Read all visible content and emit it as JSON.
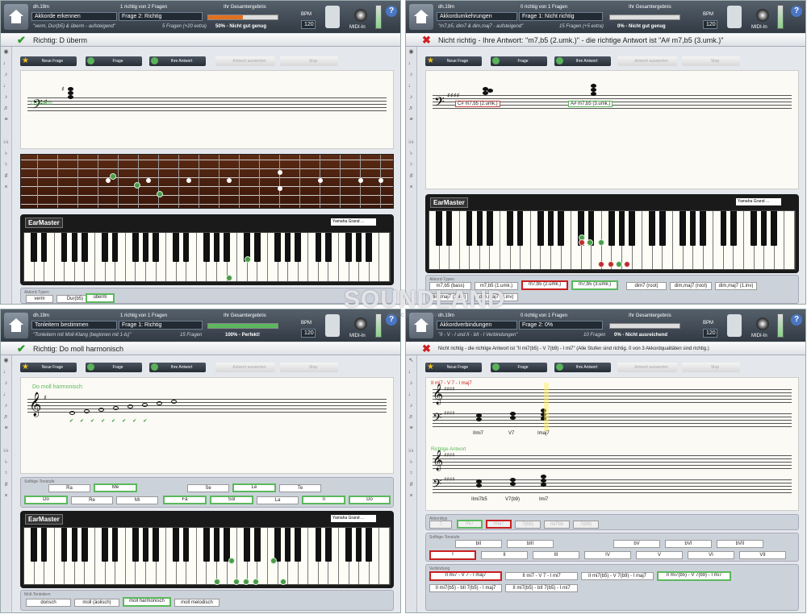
{
  "panels": [
    {
      "user": "dh.19m",
      "progress": "1 richtig von 2 Fragen",
      "result_title": "Ihr Gesamtergebnis",
      "exercise": "Akkorde erkennen",
      "question": "Frage 2: Richtig",
      "subtitle": "\"verm, Dur(b5) & überm - aufsteigend\"",
      "questions_count": "5 Fragen (+20 extra)",
      "score_text": "50% - Nicht gut genug",
      "score_fraction": 0.5,
      "score_color": "#e07020",
      "bpm_label": "BPM",
      "bpm": "120",
      "midi_label": "MIDI-In",
      "result": "Richtig: D überm",
      "result_ok": true,
      "staff_label": "D überm"
    },
    {
      "user": "dh.19m",
      "progress": "0 richtig von 1 Fragen",
      "result_title": "Ihr Gesamtergebnis",
      "exercise": "Akkordumkehrungen",
      "question": "Frage 1: Nicht richtig",
      "subtitle": "\"m7,b5, dim7 & dim,maj7 - aufsteigend\"",
      "questions_count": "15 Fragen (+5 extra)",
      "score_text": "0% - Nicht gut genug",
      "score_fraction": 0,
      "score_color": "#e07020",
      "bpm_label": "BPM",
      "bpm": "120",
      "midi_label": "MIDI-In",
      "result": "Nicht richtig - Ihre Antwort: \"m7,b5 (2.umk.)\" - die richtige Antwort ist \"A# m7,b5 (3.umk.)\"",
      "result_ok": false,
      "staff_label_1": "C# m7,b5 (2.umk.)",
      "staff_label_2": "A# m7,b5 (3.umk.)"
    },
    {
      "user": "dh.19m",
      "progress": "1 richtig von 1 Fragen",
      "result_title": "Ihr Gesamtergebnis",
      "exercise": "Tonleitern bestimmen",
      "question": "Frage 1: Richtig",
      "subtitle": "\"Tonleitern mit Moll-Klang (beginnen mit 1-ls)\"",
      "questions_count": "15 Fragen",
      "score_text": "100% - Perfekt!",
      "score_fraction": 1,
      "score_color": "#5cb85c",
      "bpm_label": "BPM",
      "bpm": "120",
      "midi_label": "MIDI-In",
      "result": "Richtig: Do moll harmonisch",
      "result_ok": true,
      "staff_label": "Do moll harmonisch"
    },
    {
      "user": "dh.19m",
      "progress": "0 richtig von 1 Fragen",
      "result_title": "Ihr Gesamtergebnis",
      "exercise": "Akkordverbindungen",
      "question": "Frage 2: 0%",
      "subtitle": "\"II - V - I und II - bII - I Verbindungen\"",
      "questions_count": "10 Fragen",
      "score_text": "0% - Nicht ausreichend",
      "score_fraction": 0,
      "score_color": "#e07020",
      "bpm_label": "BPM",
      "bpm": "120",
      "midi_label": "MIDI-In",
      "result": "Nicht richtig - die richtige Antwort ist \"II mi7(b5) - V 7(b9) - I mi7\" (Alle Stufen sind richtig. 0 von 3 Akkordqualitäten sind richtig.)",
      "result_ok": false,
      "staff_label_top": "II mi7 - V 7 - I maj7",
      "staff_label_bottom": "Richtige Antwort",
      "chord_labels_top": [
        "IImi7",
        "V7",
        "Imaj7"
      ],
      "chord_labels_bottom": [
        "IImi7b5",
        "V7(b9)",
        "Imi7"
      ]
    }
  ],
  "toolbar": {
    "new": "Neue Frage",
    "question": "Frage",
    "your_answer": "Ihre Antwort",
    "check": "Antwort auswerten",
    "stop": "Stop"
  },
  "piano": {
    "logo": "EarMaster",
    "instrument": "Yamaha Grand ..."
  },
  "q1_answers": {
    "header": "Akkord-Typen",
    "items": [
      "verm",
      "Dur(b5)",
      "überm"
    ],
    "correct": 2
  },
  "q2_answers": {
    "header": "Akkord-Typen",
    "items": [
      "m7,b5 (bass)",
      "m7,b5 (1.umk.)",
      "m7,b5 (2.umk.)",
      "m7,b5 (3.umk.)",
      "dim7 (root)",
      "dim,maj7 (root)",
      "dim,maj7 (1.inv)",
      "dim,maj7 (2.inv)",
      "dim,maj7 (3.inv)"
    ]
  },
  "q3_solfege": {
    "header": "Solfège-Tonstufe",
    "row1": [
      "Ra",
      "Me",
      "Se",
      "Le",
      "Te"
    ],
    "row2": [
      "Do",
      "Re",
      "Mi",
      "Fa",
      "Sol",
      "La",
      "Ti",
      "Do"
    ],
    "scale_header": "Moll-Tonleitern",
    "scales": [
      "dorisch",
      "moll (äolisch)",
      "moll harmonisch",
      "moll melodisch"
    ]
  },
  "q4_answers": {
    "quality_header": "Akkordtyp",
    "qualities": [
      "7",
      "mi7",
      "maj7",
      "7(b5)",
      "mi7b5",
      "7(b9)"
    ],
    "degree_header": "Solfège-Tonstufe",
    "degrees_top": [
      "bII",
      "bIII",
      "bV",
      "bVI",
      "bVII"
    ],
    "degrees": [
      "I",
      "II",
      "III",
      "IV",
      "V",
      "VI",
      "VII"
    ],
    "prog_header": "Verbindung",
    "progs": [
      "II mi7 - V 7 - I maj7",
      "II mi7 - V 7 - I mi7",
      "II mi7(b5) - V 7(b9) - I maj7",
      "II mi7(b5) - V 7(b9) - I mi7",
      "II mi7(b5) - bII 7(b5) - I maj7",
      "II mi7(b5) - bII 7(b5) - I mi7"
    ]
  },
  "watermark": "SOUNDLAND",
  "watermark_sub": "music & electronic"
}
